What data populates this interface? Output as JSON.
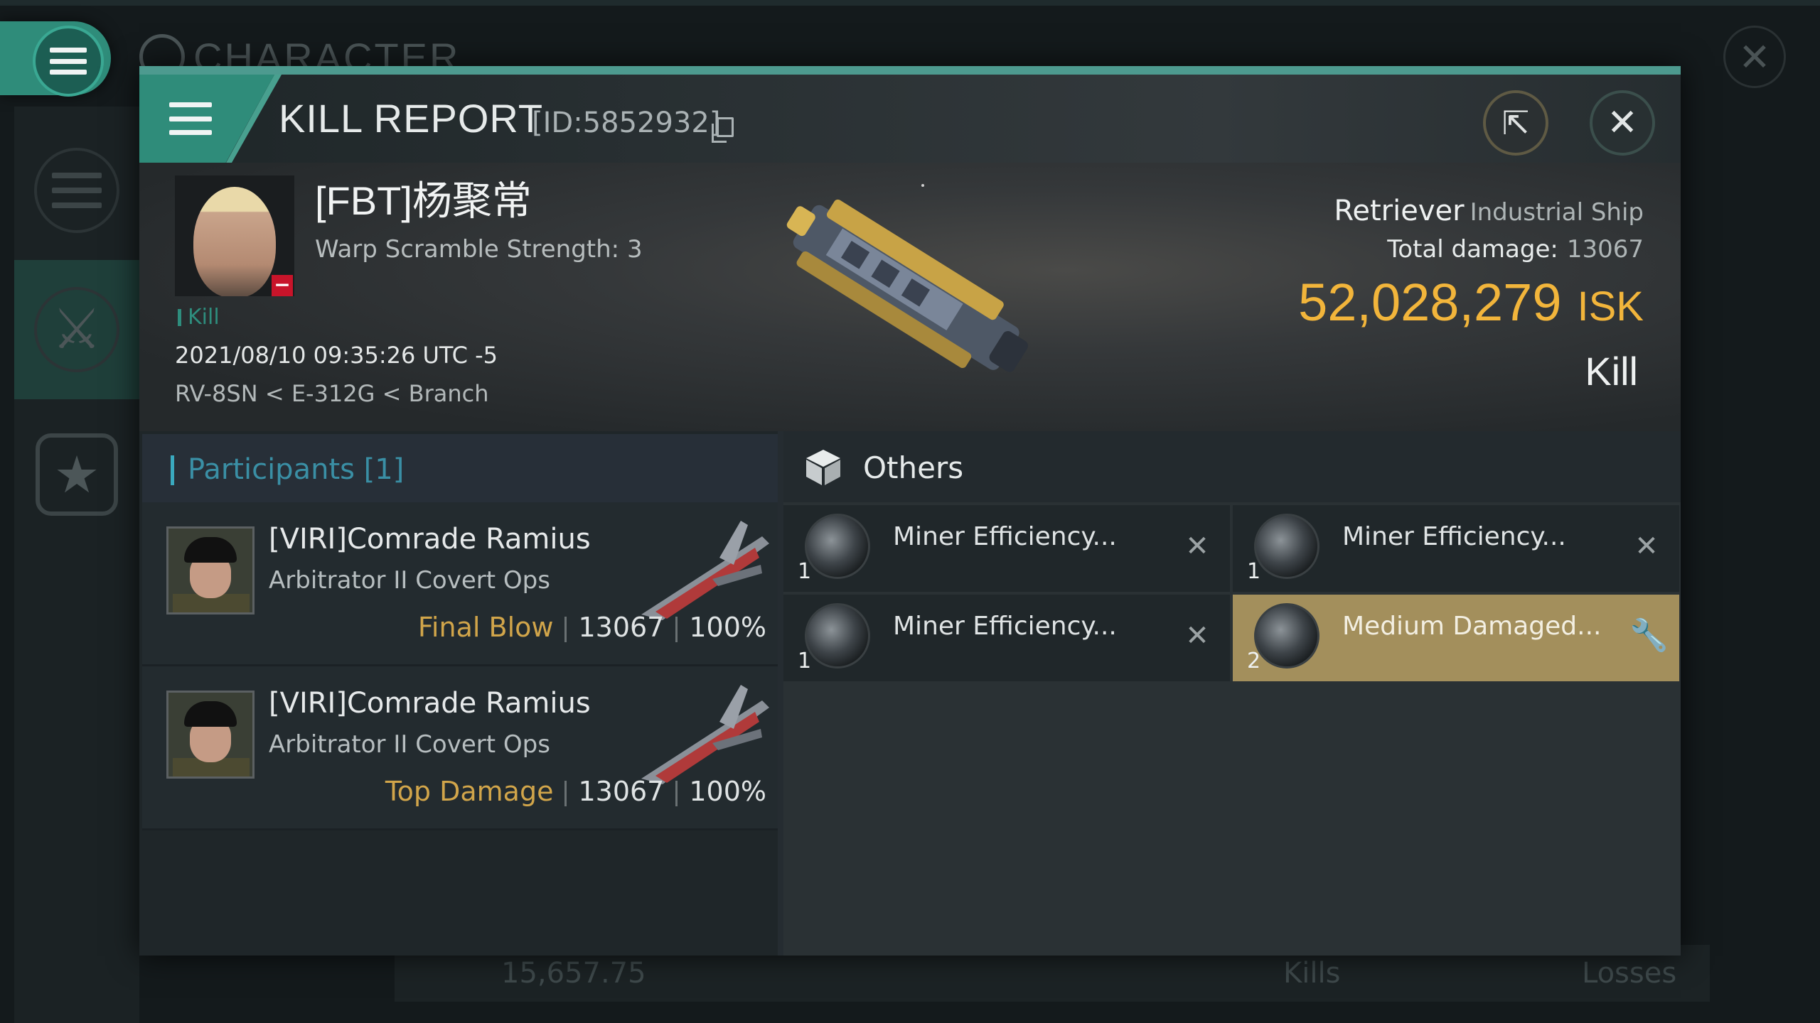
{
  "background": {
    "title": "CHARACTER",
    "footer": {
      "value": "15,657.75",
      "kills_label": "Kills",
      "losses_label": "Losses"
    }
  },
  "dialog": {
    "title": "KILL REPORT",
    "id": "[ID:5852932]",
    "icons": {
      "share": "share-icon",
      "close": "close-icon",
      "copy": "copy-icon"
    }
  },
  "victim": {
    "name": "[FBT]杨聚常",
    "warp_scramble": "Warp Scramble Strength: 3",
    "tag": "Kill",
    "timestamp": "2021/08/10 09:35:26 UTC -5",
    "location": "RV-8SN < E-312G < Branch",
    "ship_name": "Retriever",
    "ship_class": "Industrial Ship",
    "total_damage_label": "Total damage:",
    "total_damage": "13067",
    "isk_value": "52,028,279",
    "isk_unit": "ISK",
    "result": "Kill"
  },
  "participants": {
    "title": "Participants [1]",
    "list": [
      {
        "name": "[VIRI]Comrade Ramius",
        "ship": "Arbitrator II Covert Ops",
        "role": "Final Blow",
        "damage": "13067",
        "percent": "100%"
      },
      {
        "name": "[VIRI]Comrade Ramius",
        "ship": "Arbitrator II Covert Ops",
        "role": "Top Damage",
        "damage": "13067",
        "percent": "100%"
      }
    ]
  },
  "others": {
    "title": "Others",
    "items": [
      {
        "name": "Miner Efficiency...",
        "qty": "1",
        "status": "destroyed"
      },
      {
        "name": "Miner Efficiency...",
        "qty": "1",
        "status": "destroyed"
      },
      {
        "name": "Miner Efficiency...",
        "qty": "1",
        "status": "destroyed"
      },
      {
        "name": "Medium Damaged...",
        "qty": "2",
        "status": "dropped"
      }
    ]
  },
  "colors": {
    "accent": "#2f8c7a",
    "isk": "#f2b53b",
    "role": "#d1a54a",
    "dropped": "#a38f5c"
  }
}
